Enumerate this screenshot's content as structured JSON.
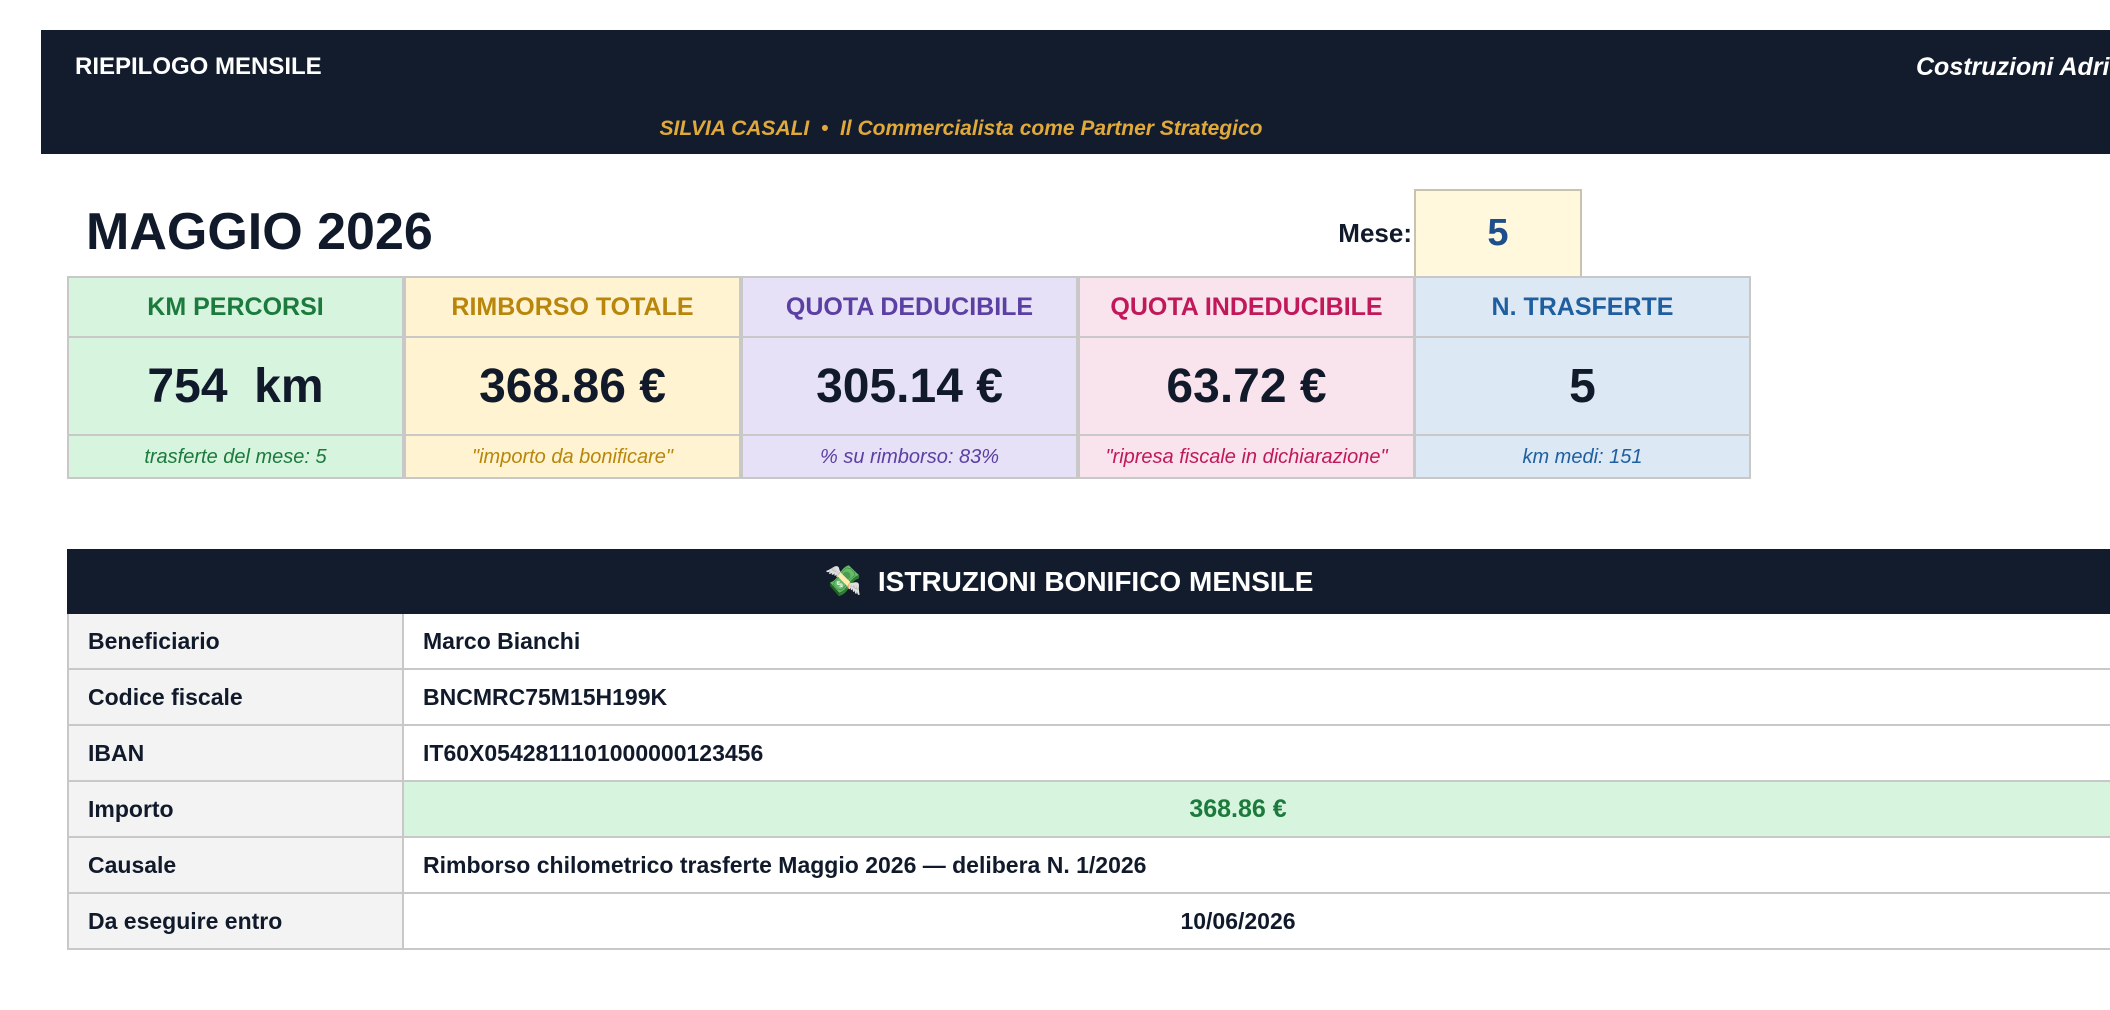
{
  "header": {
    "title": "RIEPILOGO MENSILE",
    "company": "Costruzioni Adri",
    "subtitle": "SILVIA CASALI  •  Il Commercialista come Partner Strategico"
  },
  "month": {
    "title": "MAGGIO 2026",
    "mese_label": "Mese:",
    "mese_value": "5"
  },
  "kpis": [
    {
      "label": "KM PERCORSI",
      "value": "754  km",
      "note": "trasferte del mese: 5",
      "bg": "#d7f4df",
      "accent": "#1b7a3c"
    },
    {
      "label": "RIMBORSO TOTALE",
      "value": "368.86 €",
      "note": "\"importo da bonificare\"",
      "bg": "#fff3d1",
      "accent": "#b8860b"
    },
    {
      "label": "QUOTA DEDUCIBILE",
      "value": "305.14 €",
      "note": "% su rimborso: 83%",
      "bg": "#e6e1f6",
      "accent": "#5b3fa3"
    },
    {
      "label": "QUOTA INDEDUCIBILE",
      "value": "63.72 €",
      "note": "\"ripresa fiscale in dichiarazione\"",
      "bg": "#f9e3ec",
      "accent": "#c0185a"
    },
    {
      "label": "N. TRASFERTE",
      "value": "5",
      "note": "km medi: 151",
      "bg": "#dce9f4",
      "accent": "#1f5fa0"
    }
  ],
  "instructions": {
    "icon": "money-with-wings-icon",
    "icon_glyph": "💸",
    "title": "ISTRUZIONI BONIFICO MENSILE",
    "rows": [
      {
        "label": "Beneficiario",
        "value": "Marco Bianchi"
      },
      {
        "label": "Codice fiscale",
        "value": "BNCMRC75M15H199K"
      },
      {
        "label": "IBAN",
        "value": "IT60X0542811101000000123456"
      },
      {
        "label": "Importo",
        "value": "368.86 €"
      },
      {
        "label": "Causale",
        "value": "Rimborso chilometrico trasferte Maggio 2026 — delibera N. 1/2026"
      },
      {
        "label": "Da eseguire entro",
        "value": "10/06/2026"
      }
    ]
  }
}
